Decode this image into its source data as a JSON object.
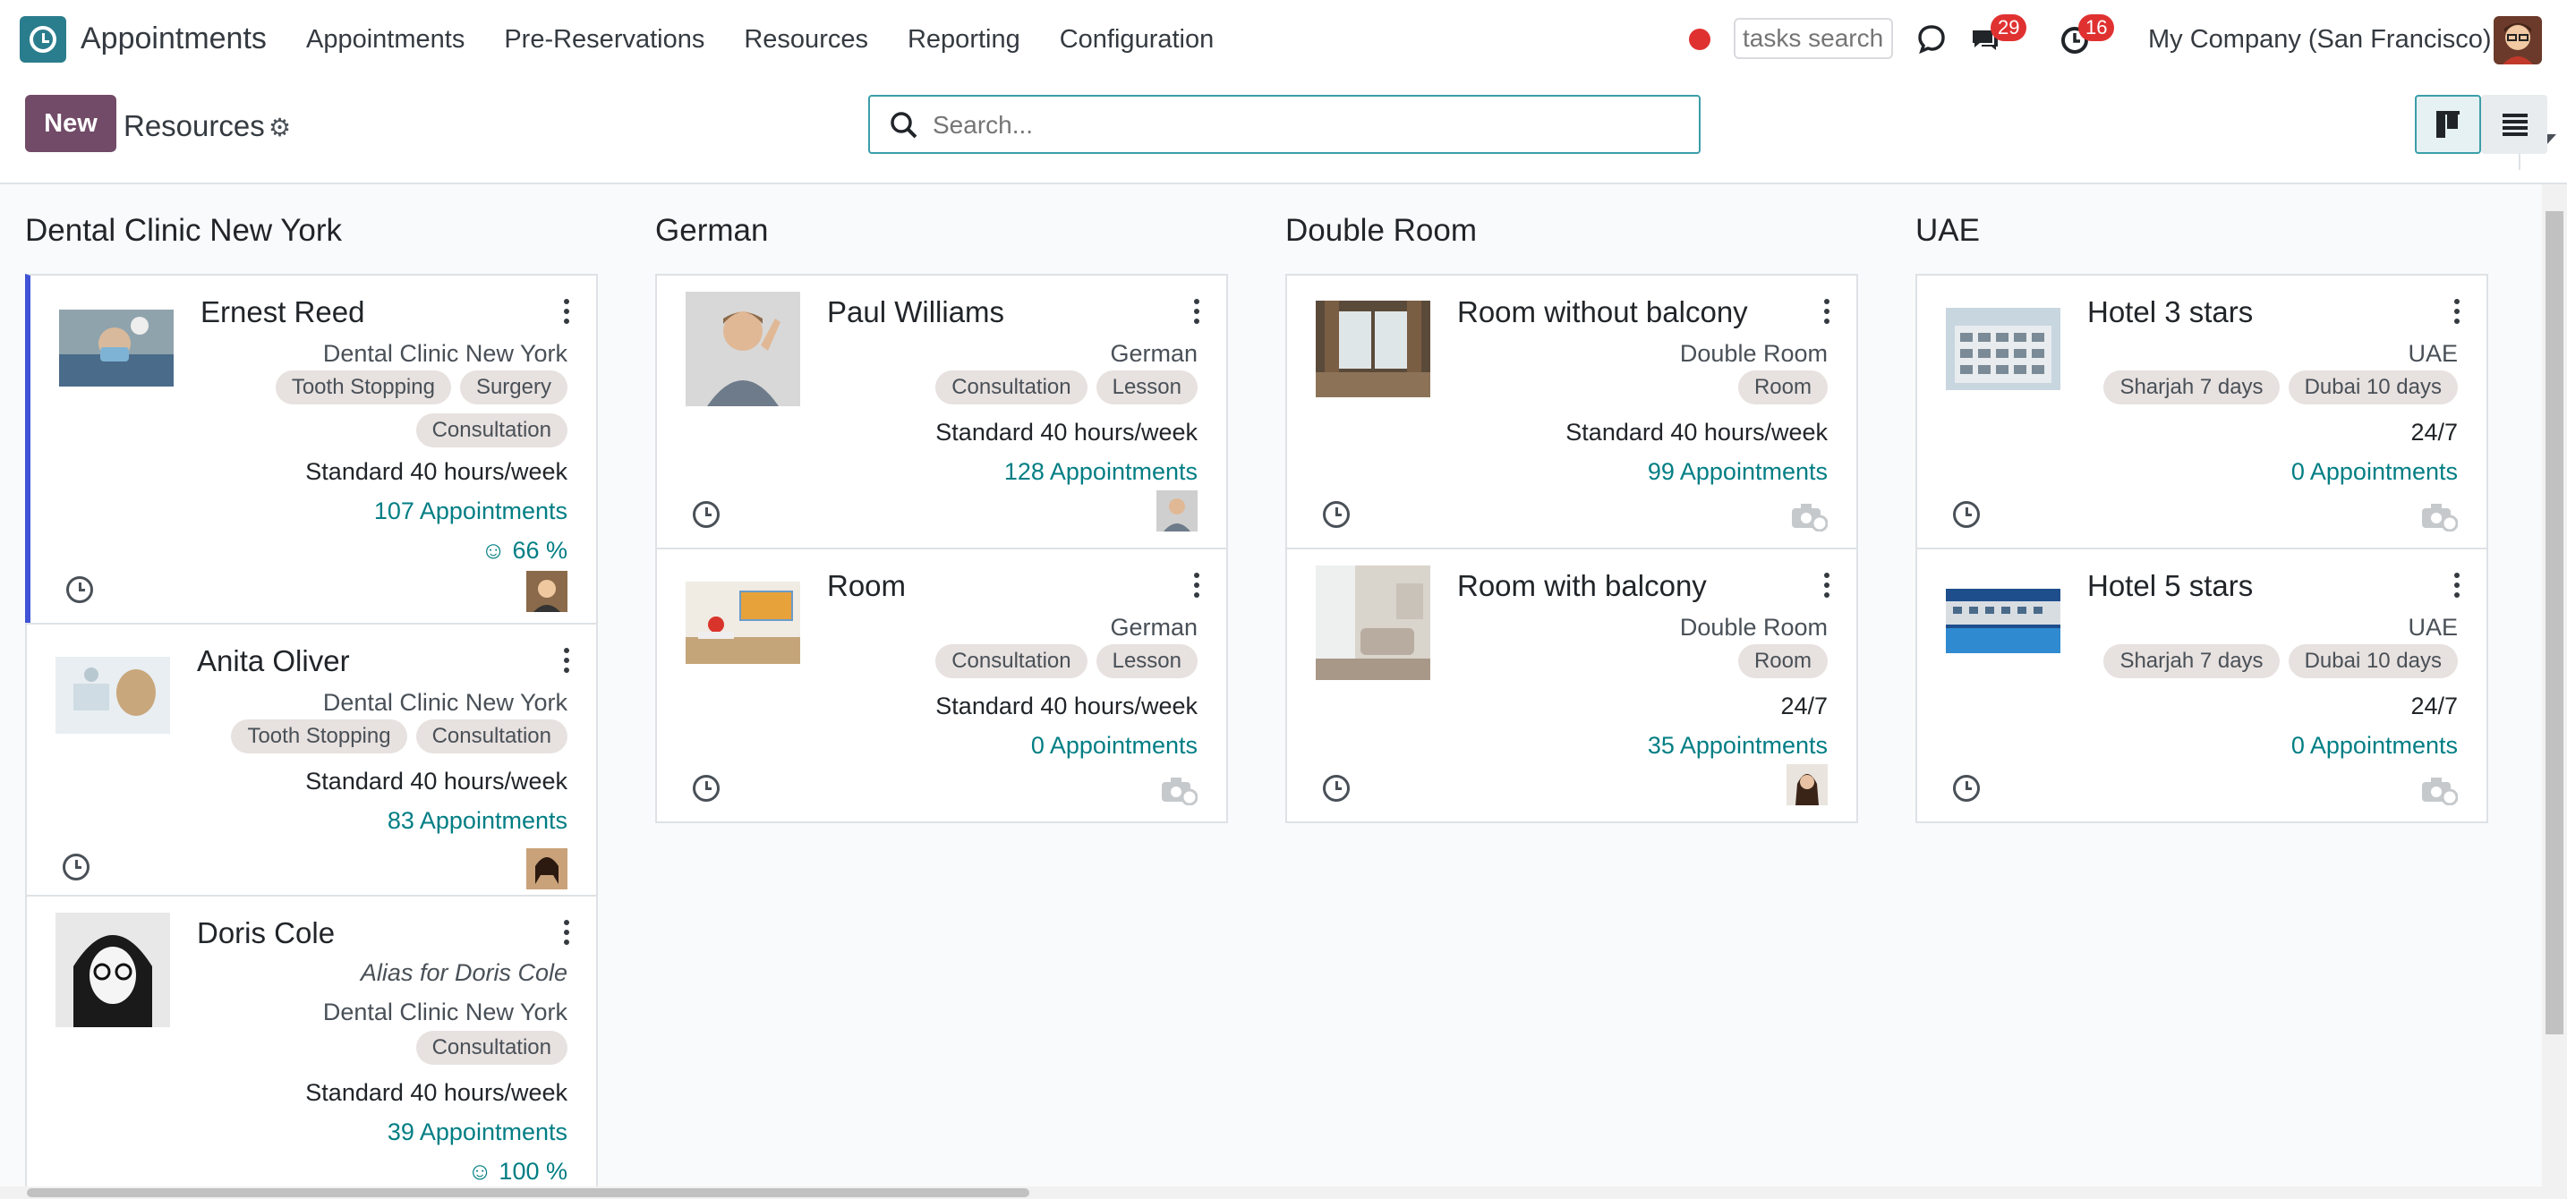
{
  "navbar": {
    "app_title": "Appointments",
    "menu": [
      "Appointments",
      "Pre-Reservations",
      "Resources",
      "Reporting",
      "Configuration"
    ],
    "tasks_search_placeholder": "tasks search",
    "messages_count": "29",
    "activities_count": "16",
    "company": "My Company (San Francisco)"
  },
  "control": {
    "new_label": "New",
    "title": "Resources",
    "search_placeholder": "Search..."
  },
  "columns": [
    {
      "title": "Dental Clinic New York",
      "cards": [
        {
          "name": "Ernest Reed",
          "subtitle": "Dental Clinic New York",
          "tags": [
            "Tooth Stopping",
            "Surgery",
            "Consultation"
          ],
          "schedule": "Standard 40 hours/week",
          "appointments": "107 Appointments",
          "rating": "☺ 66 %"
        },
        {
          "name": "Anita Oliver",
          "subtitle": "Dental Clinic New York",
          "tags": [
            "Tooth Stopping",
            "Consultation"
          ],
          "schedule": "Standard 40 hours/week",
          "appointments": "83 Appointments"
        },
        {
          "name": "Doris Cole",
          "alias": "Alias for Doris Cole",
          "subtitle": "Dental Clinic New York",
          "tags": [
            "Consultation"
          ],
          "schedule": "Standard 40 hours/week",
          "appointments": "39 Appointments",
          "rating": "☺ 100 %"
        }
      ]
    },
    {
      "title": "German",
      "cards": [
        {
          "name": "Paul Williams",
          "subtitle": "German",
          "tags": [
            "Consultation",
            "Lesson"
          ],
          "schedule": "Standard 40 hours/week",
          "appointments": "128 Appointments"
        },
        {
          "name": "Room",
          "subtitle": "German",
          "tags": [
            "Consultation",
            "Lesson"
          ],
          "schedule": "Standard 40 hours/week",
          "appointments": "0 Appointments"
        }
      ]
    },
    {
      "title": "Double Room",
      "cards": [
        {
          "name": "Room without balcony",
          "subtitle": "Double Room",
          "tags": [
            "Room"
          ],
          "schedule": "Standard 40 hours/week",
          "appointments": "99 Appointments"
        },
        {
          "name": "Room with balcony",
          "subtitle": "Double Room",
          "tags": [
            "Room"
          ],
          "schedule": "24/7",
          "appointments": "35 Appointments"
        }
      ]
    },
    {
      "title": "UAE",
      "cards": [
        {
          "name": "Hotel 3 stars",
          "subtitle": "UAE",
          "tags": [
            "Sharjah 7 days",
            "Dubai 10 days"
          ],
          "schedule": "24/7",
          "appointments": "0 Appointments"
        },
        {
          "name": "Hotel 5 stars",
          "subtitle": "UAE",
          "tags": [
            "Sharjah 7 days",
            "Dubai 10 days"
          ],
          "schedule": "24/7",
          "appointments": "0 Appointments"
        }
      ]
    }
  ],
  "colors": {
    "brand": "#714b67",
    "link": "#017e84",
    "accent": "#3b9ea8",
    "selected_border": "#4052d6",
    "badge": "#e03131"
  }
}
